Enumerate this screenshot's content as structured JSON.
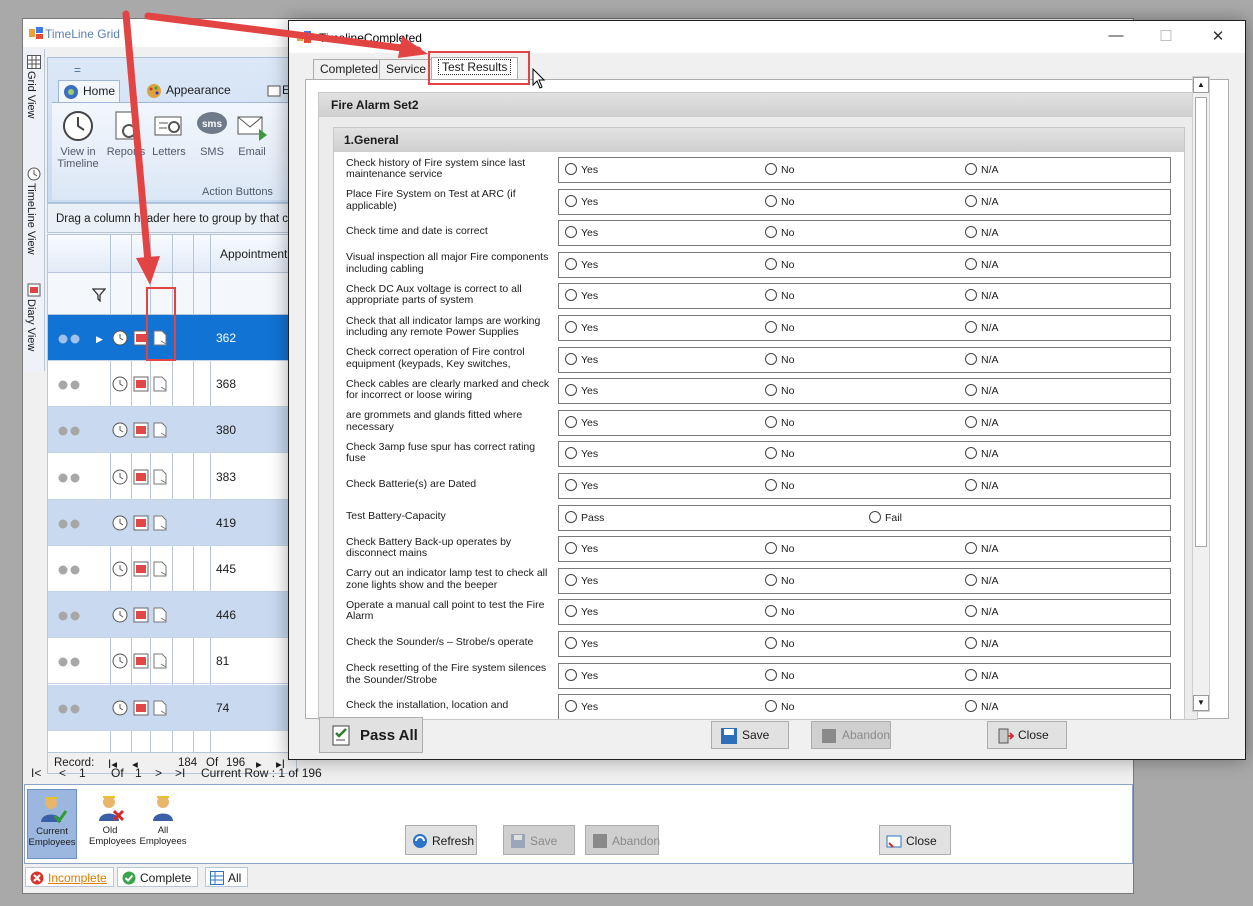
{
  "back_window": {
    "title": "TimeLine Grid",
    "side_tabs": [
      {
        "label": "Grid View",
        "icon": "grid-icon"
      },
      {
        "label": "TimeLine View",
        "icon": "clock-icon"
      },
      {
        "label": "Diary View",
        "icon": "diary-icon"
      }
    ],
    "ribbon": {
      "qat": "=",
      "tabs": [
        {
          "label": "Home",
          "icon": "home-icon"
        },
        {
          "label": "Appearance",
          "icon": "palette-icon"
        },
        {
          "label": "E",
          "icon": "export-icon"
        }
      ],
      "buttons": [
        {
          "label": "View in Timeline",
          "icon": "clock-icon"
        },
        {
          "label": "Reports",
          "icon": "report-icon"
        },
        {
          "label": "Letters",
          "icon": "letters-icon"
        },
        {
          "label": "SMS",
          "icon": "sms-icon"
        },
        {
          "label": "Email",
          "icon": "email-icon"
        }
      ],
      "group_label": "Action Buttons"
    },
    "group_hint": "Drag a column header here to group by that c",
    "grid": {
      "column_header": "AppointmentI",
      "rows": [
        {
          "id": "362",
          "selected": true
        },
        {
          "id": "368",
          "selected": false
        },
        {
          "id": "380",
          "selected": false
        },
        {
          "id": "383",
          "selected": false
        },
        {
          "id": "419",
          "selected": false
        },
        {
          "id": "445",
          "selected": false
        },
        {
          "id": "446",
          "selected": false
        },
        {
          "id": "81",
          "selected": false
        },
        {
          "id": "74",
          "selected": false
        }
      ]
    },
    "record_nav": {
      "label": "Record:",
      "first": "I◂",
      "prev": "◂",
      "current": "184",
      "of": "Of",
      "total": "196",
      "next": "▸",
      "last": "▸I"
    },
    "pager": {
      "first": "I<",
      "prev": "<",
      "page": "1",
      "of": "Of",
      "pages": "1",
      "next": ">",
      "last": ">I",
      "current_row": "Current Row : 1 of 196"
    },
    "employees": [
      {
        "label": "Current Employees",
        "icon": "employee-check-icon"
      },
      {
        "label": "Old Employees",
        "icon": "employee-x-icon"
      },
      {
        "label": "All Employees",
        "icon": "employee-icon"
      }
    ],
    "buttons": {
      "refresh": "Refresh",
      "save": "Save",
      "abandon": "Abandon",
      "close": "Close"
    },
    "status_tabs": [
      {
        "label": "Incomplete",
        "icon": "red-x-icon"
      },
      {
        "label": "Complete",
        "icon": "green-check-icon"
      },
      {
        "label": "All",
        "icon": "grid-icon"
      }
    ]
  },
  "dialog": {
    "title": "TimelineCompleted",
    "controls": {
      "minimize": "—",
      "maximize": "☐",
      "close": "✕"
    },
    "tabs": [
      "Completed",
      "Service",
      "Test Results"
    ],
    "section_title": "Fire Alarm Set2",
    "subsection_title": "1.General",
    "questions": [
      {
        "label": "Check history of Fire system since last maintenance service",
        "options": [
          "Yes",
          "No",
          "N/A"
        ]
      },
      {
        "label": "Place Fire System on Test at ARC (if applicable)",
        "options": [
          "Yes",
          "No",
          "N/A"
        ]
      },
      {
        "label": "Check time and date is correct",
        "options": [
          "Yes",
          "No",
          "N/A"
        ]
      },
      {
        "label": "Visual inspection all major Fire components including cabling",
        "options": [
          "Yes",
          "No",
          "N/A"
        ]
      },
      {
        "label": "Check DC Aux voltage is correct to all appropriate parts of system",
        "options": [
          "Yes",
          "No",
          "N/A"
        ]
      },
      {
        "label": "Check that all indicator lamps are working including any remote Power Supplies",
        "options": [
          "Yes",
          "No",
          "N/A"
        ]
      },
      {
        "label": "Check correct operation of Fire control equipment (keypads, Key switches,",
        "options": [
          "Yes",
          "No",
          "N/A"
        ]
      },
      {
        "label": "Check cables are clearly marked and check for incorrect or loose wiring",
        "options": [
          "Yes",
          "No",
          "N/A"
        ]
      },
      {
        "label": "are grommets and glands fitted where necessary",
        "options": [
          "Yes",
          "No",
          "N/A"
        ]
      },
      {
        "label": "Check 3amp fuse spur has correct rating fuse",
        "options": [
          "Yes",
          "No",
          "N/A"
        ]
      },
      {
        "label": "Check Batterie(s) are Dated",
        "options": [
          "Yes",
          "No",
          "N/A"
        ]
      },
      {
        "label": "Test Battery-Capacity",
        "options": [
          "Pass",
          "Fail"
        ]
      },
      {
        "label": "Check Battery Back-up operates by disconnect mains",
        "options": [
          "Yes",
          "No",
          "N/A"
        ]
      },
      {
        "label": "Carry out an indicator lamp test to check all zone lights show and the beeper",
        "options": [
          "Yes",
          "No",
          "N/A"
        ]
      },
      {
        "label": "Operate a manual call point to test the Fire Alarm",
        "options": [
          "Yes",
          "No",
          "N/A"
        ]
      },
      {
        "label": "Check the Sounder/s – Strobe/s operate",
        "options": [
          "Yes",
          "No",
          "N/A"
        ]
      },
      {
        "label": "Check resetting of the Fire system silences the Sounder/Strobe",
        "options": [
          "Yes",
          "No",
          "N/A"
        ]
      },
      {
        "label": "Check the installation, location and",
        "options": [
          "Yes",
          "No",
          "N/A"
        ]
      }
    ],
    "footer": {
      "pass_all": "Pass All",
      "save": "Save",
      "abandon": "Abandon",
      "close": "Close"
    }
  },
  "colors": {
    "selection": "#1173d4",
    "alt_row": "#c9daf0",
    "annotation": "#e24343"
  }
}
